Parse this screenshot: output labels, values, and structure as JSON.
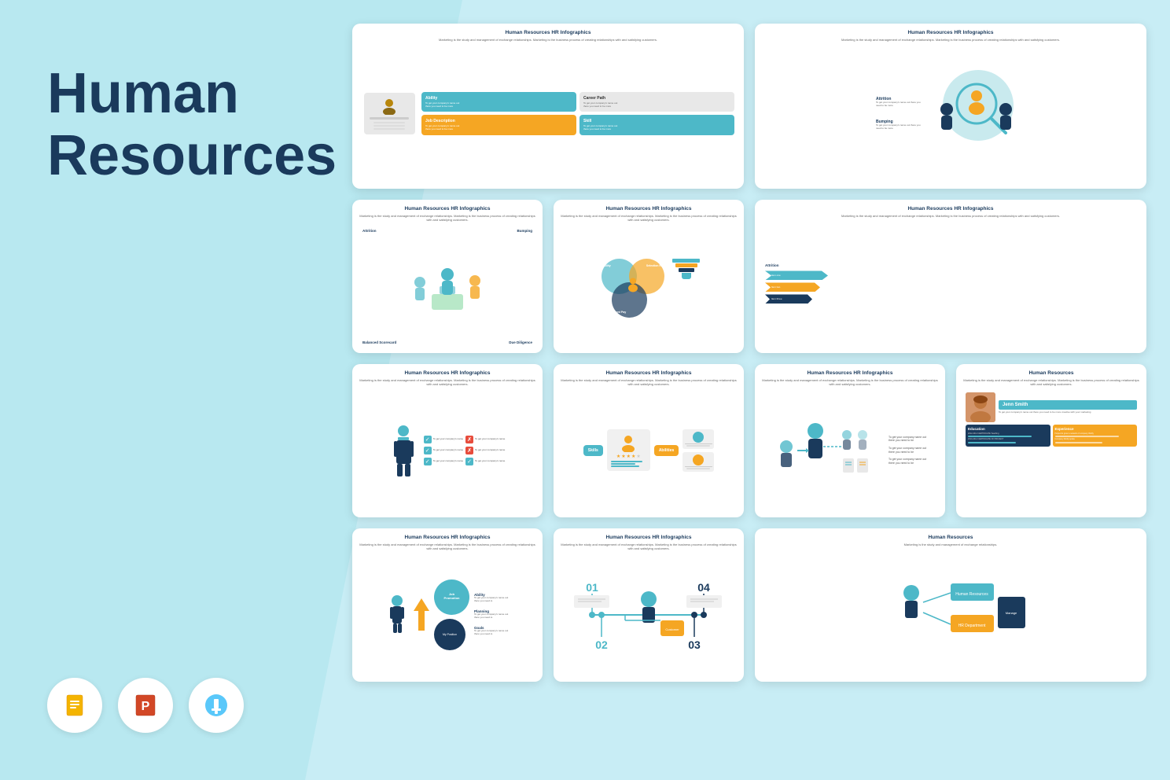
{
  "page": {
    "title": "Human Resources",
    "bg_color": "#b8e8f0"
  },
  "left_panel": {
    "title_line1": "Human",
    "title_line2": "Resources",
    "format_icons": [
      {
        "name": "google-slides-icon",
        "label": "Google Slides",
        "color": "#f4b400"
      },
      {
        "name": "powerpoint-icon",
        "label": "PowerPoint",
        "color": "#d24726"
      },
      {
        "name": "keynote-icon",
        "label": "Keynote",
        "color": "#5ac8fa"
      }
    ]
  },
  "slides": {
    "slide1": {
      "title": "Human Resources HR Infographics",
      "subtitle": "Marketing is the study and management of exchange relationships. Marketing is the business process of creating relationships with and satisfying customers.",
      "type": "profile-quadrant"
    },
    "slide2": {
      "title": "Human Resources HR Infographics",
      "subtitle": "Marketing is the study and management of exchange relationships. Marketing is the business process of creating relationships with and satisfying customers.",
      "type": "recruitment-partial"
    },
    "slide3": {
      "title": "Human Resources HR Infographics",
      "subtitle": "Marketing is the study and management of exchange relationships. Marketing is the business process of creating relationships with and satisfying customers.",
      "type": "attrition-bumping",
      "labels": {
        "attrition": "Attrition",
        "bumping": "Bumping",
        "balanced_scorecard": "Balanced Scorecard",
        "due_diligence": "Due Diligence"
      }
    },
    "slide4": {
      "title": "Human Resources HR Infographics",
      "subtitle": "Marketing is the study and management of exchange relationships. Marketing is the business process of creating relationships with and satisfying customers.",
      "type": "venn-circles",
      "labels": {
        "ability": "Ability",
        "selection_rate": "Selection Rate",
        "front_pay": "Front Pay"
      }
    },
    "slide5": {
      "title": "Human Resources HR Infographics",
      "subtitle": "Marketing is the study and management of exchange relationships. Marketing is the business process of creating relationships with and satisfying customers.",
      "type": "attrition-chevron",
      "labels": {
        "attrition": "Attrition"
      }
    },
    "slide6": {
      "title": "Human Resources HR Infographics",
      "subtitle": "Marketing is the study and management of exchange relationships. Marketing is the business process of creating relationships with and satisfying customers.",
      "type": "checklist",
      "labels": {
        "checks": "Checklist items"
      }
    },
    "slide7": {
      "title": "Human Resources HR Infographics",
      "subtitle": "Marketing is the study and management of exchange relationships. Marketing is the business process of creating relationships with and satisfying customers.",
      "type": "skills-id-card",
      "labels": {
        "skills": "Skills",
        "abilities": "Abilities"
      }
    },
    "slide8": {
      "title": "Human Resources HR Infographics",
      "subtitle": "Marketing is the study and management of exchange relationships. Marketing is the business process of creating relationships with and satisfying customers.",
      "type": "person-arrows"
    },
    "slide9": {
      "title": "Human Resources",
      "subtitle": "Marketing is the study and management of exchange relationships. Marketing is the business process of creating relationships with and satisfying customers.",
      "type": "jenn-smith",
      "name": "Jenn Smith",
      "sections": {
        "education": "Education",
        "experience": "Experience"
      }
    },
    "slide10": {
      "title": "Human Resources HR Infographics",
      "subtitle": "Marketing is the study and management of exchange relationships. Marketing is the business process of creating relationships with and satisfying customers.",
      "type": "job-promotion",
      "labels": {
        "job_promotion": "Job Promotion",
        "ability": "Ability",
        "planning": "Planning",
        "goals": "Goals",
        "my_position": "My Position"
      }
    },
    "slide11": {
      "title": "Human Resources HR Infographics",
      "subtitle": "Marketing is the study and management of exchange relationships. Marketing is the business process of creating relationships with and satisfying customers.",
      "type": "timeline",
      "numbers": [
        "01",
        "02",
        "03",
        "04"
      ]
    },
    "slide12": {
      "title": "Human Resources",
      "subtitle": "Marketing is the study and management of exchange relationships.",
      "type": "partial-orange"
    }
  }
}
